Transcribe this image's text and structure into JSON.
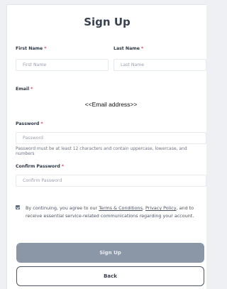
{
  "form": {
    "title": "Sign Up",
    "first_name": {
      "label": "First Name",
      "required_mark": "*",
      "placeholder": "First Name",
      "value": ""
    },
    "last_name": {
      "label": "Last Name",
      "required_mark": "*",
      "placeholder": "Last Name",
      "value": ""
    },
    "email": {
      "label": "Email",
      "required_mark": "*",
      "value": "<<Email address>>"
    },
    "password": {
      "label": "Password",
      "required_mark": "*",
      "placeholder": "Password",
      "hint": "Password must be at least 12 characters and contain uppercase, lowercase, and numbers"
    },
    "confirm_password": {
      "label": "Confirm Password",
      "required_mark": "*",
      "placeholder": "Confirm Password"
    },
    "consent": {
      "checked": true,
      "text_before": "By continuing, you agree to our ",
      "terms_link": "Terms & Conditions",
      "separator": ", ",
      "privacy_link": "Privacy Policy",
      "text_after": ", and to receive essential service-related communications regarding your account."
    },
    "submit_label": "Sign Up",
    "back_label": "Back"
  },
  "colors": {
    "required": "#e0465b",
    "primary_button": "#8b97a7",
    "page_background": "#eef0f3"
  }
}
